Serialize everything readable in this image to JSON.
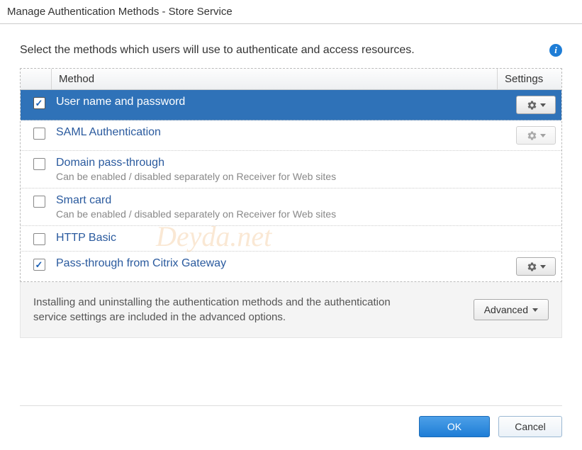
{
  "window": {
    "title": "Manage Authentication Methods - Store Service"
  },
  "instruction": "Select the methods which users will use to authenticate and access resources.",
  "columns": {
    "method": "Method",
    "settings": "Settings"
  },
  "rows": [
    {
      "label": "User name and password",
      "desc": "",
      "checked": true,
      "selected": true,
      "settings_enabled": true
    },
    {
      "label": "SAML Authentication",
      "desc": "",
      "checked": false,
      "selected": false,
      "settings_enabled": false
    },
    {
      "label": "Domain pass-through",
      "desc": "Can be enabled / disabled separately on Receiver for Web sites",
      "checked": false,
      "selected": false,
      "settings_enabled": null
    },
    {
      "label": "Smart card",
      "desc": "Can be enabled / disabled separately on Receiver for Web sites",
      "checked": false,
      "selected": false,
      "settings_enabled": null
    },
    {
      "label": "HTTP Basic",
      "desc": "",
      "checked": false,
      "selected": false,
      "settings_enabled": null
    },
    {
      "label": "Pass-through from Citrix Gateway",
      "desc": "",
      "checked": true,
      "selected": false,
      "settings_enabled": true
    }
  ],
  "footer": {
    "text": "Installing and uninstalling the authentication methods and the authentication service settings are included in the advanced options.",
    "advanced": "Advanced"
  },
  "buttons": {
    "ok": "OK",
    "cancel": "Cancel"
  },
  "watermark": "Deyda.net"
}
